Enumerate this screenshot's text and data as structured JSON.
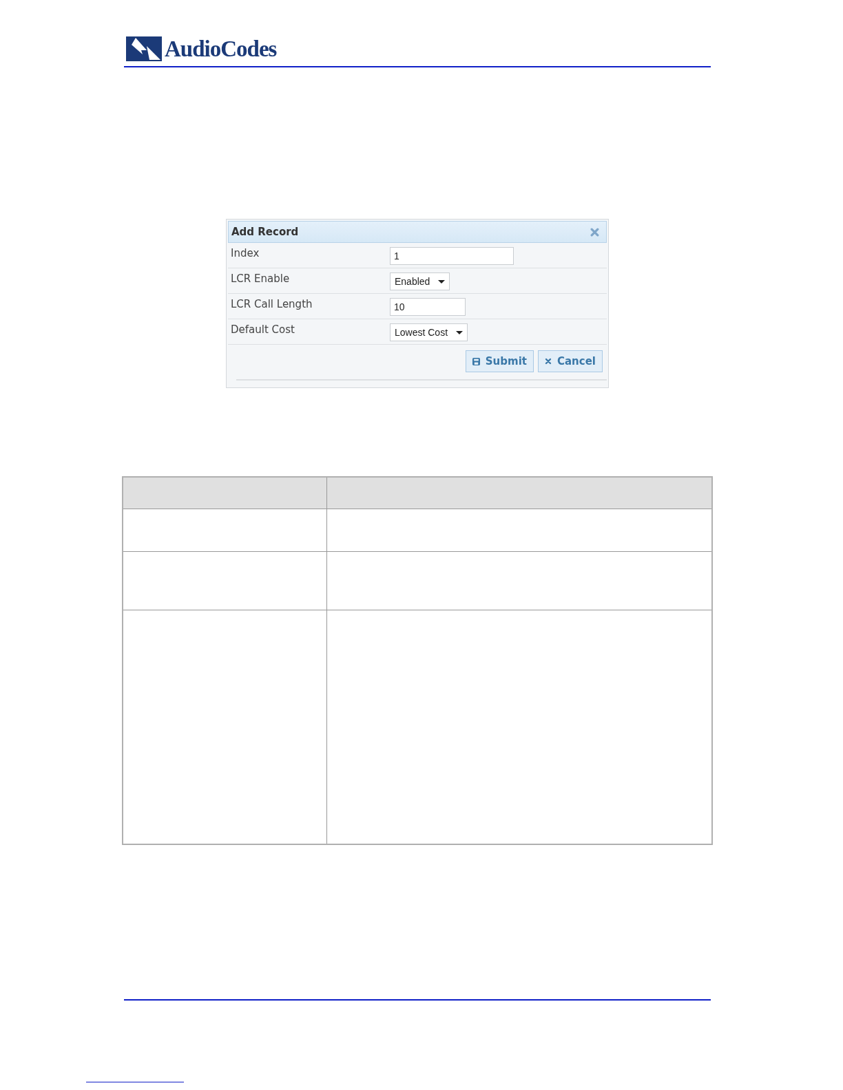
{
  "header": {
    "logo_text": "AudioCodes"
  },
  "dialog": {
    "title": "Add Record",
    "fields": [
      {
        "label": "Index",
        "kind": "text",
        "value": "1"
      },
      {
        "label": "LCR Enable",
        "kind": "select",
        "value": "Enabled"
      },
      {
        "label": "LCR Call Length",
        "kind": "text",
        "value": "10"
      },
      {
        "label": "Default Cost",
        "kind": "select",
        "value": "Lowest Cost"
      }
    ],
    "buttons": [
      {
        "label": "Submit",
        "kind": "submit"
      },
      {
        "label": "Cancel",
        "kind": "cancel"
      }
    ]
  }
}
